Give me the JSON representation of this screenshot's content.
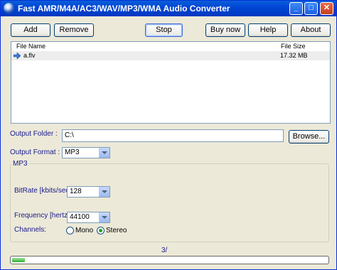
{
  "window": {
    "title": "Fast AMR/M4A/AC3/WAV/MP3/WMA Audio Converter",
    "controls": {
      "minimize": "_",
      "maximize": "□",
      "close": "✕"
    }
  },
  "toolbar": {
    "add": "Add",
    "remove": "Remove",
    "stop": "Stop",
    "buy_now": "Buy now",
    "help": "Help",
    "about": "About"
  },
  "file_list": {
    "columns": [
      "File Name",
      "File Size"
    ],
    "rows": [
      {
        "name": "a.flv",
        "size": "17.32 MB",
        "icon": "arrow-right-icon"
      }
    ]
  },
  "output_folder": {
    "label": "Output Folder :",
    "value": "C:\\",
    "browse": "Browse..."
  },
  "output_format": {
    "label": "Output Format :",
    "value": "MP3"
  },
  "mp3_group": {
    "title": "MP3",
    "bitrate": {
      "label": "BitRate [kbits/sec]",
      "value": "128"
    },
    "frequency": {
      "label": "Frequency [hertz]",
      "value": "44100"
    },
    "channels": {
      "label": "Channels:",
      "options": [
        "Mono",
        "Stereo"
      ],
      "selected": "Stereo"
    }
  },
  "status": {
    "text": "3/",
    "progress": 0.04
  }
}
